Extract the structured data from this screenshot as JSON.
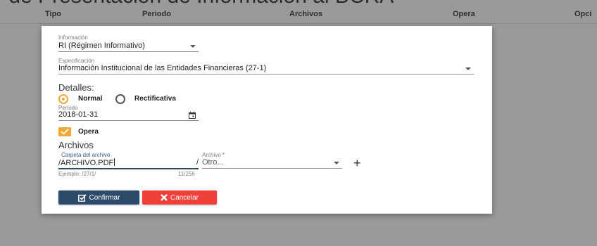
{
  "background": {
    "title": "r de Presentación de Información al BCRA",
    "columns": [
      "Tipo",
      "Periodo",
      "Archivos",
      "Opera",
      "Opci"
    ]
  },
  "modal": {
    "informacion": {
      "label": "Información",
      "value": "RI (Régimen Informativo)"
    },
    "especificacion": {
      "label": "Especificación",
      "value": "Información Institucional de las Entidades Financieras (27-1)"
    },
    "detalles": {
      "title": "Detalles:",
      "radio_normal": "Normal",
      "radio_rectificativa": "Rectificativa",
      "selected": "Normal"
    },
    "periodo": {
      "label": "Periodo",
      "value": "2018-01-31"
    },
    "opera": {
      "label": "Opera",
      "checked": true
    },
    "archivos": {
      "title": "Archivos",
      "carpeta_label": "Carpeta del archivo",
      "carpeta_value": "/ARCHIVO.PDF",
      "hint": "Ejemplo: /27/1/",
      "counter": "11/256",
      "separator": "/",
      "archivo_label": "Archivo *",
      "archivo_value": "Otro..."
    },
    "buttons": {
      "confirm": "Confirmar",
      "cancel": "Cancelar"
    },
    "colors": {
      "accent": "#f0a836",
      "confirm": "#2d4a6b",
      "cancel": "#f0403a"
    },
    "icons": [
      "calendar-icon",
      "check-icon",
      "plus-icon",
      "edit-icon",
      "close-icon"
    ]
  }
}
